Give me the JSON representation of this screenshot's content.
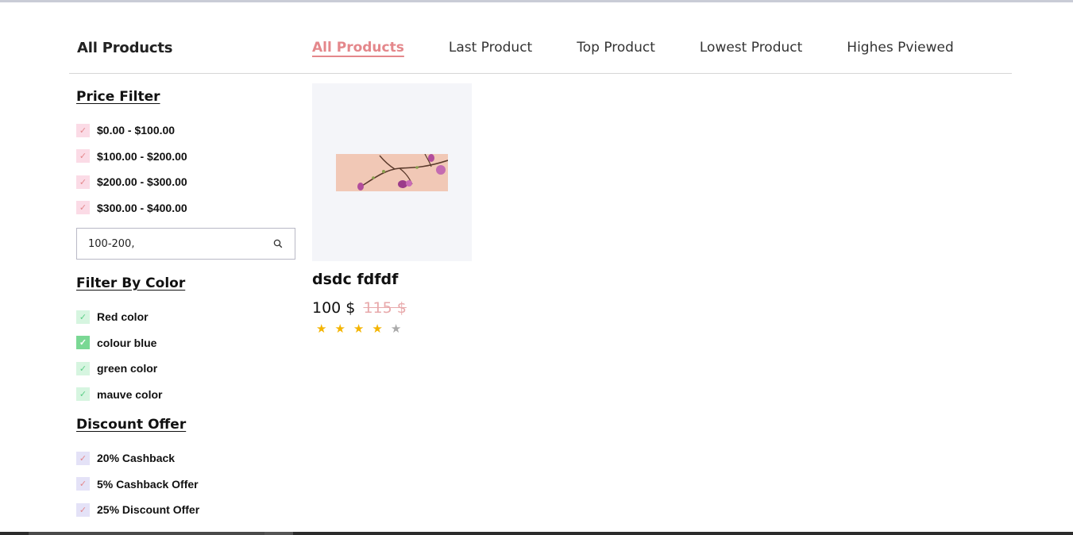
{
  "header": {
    "title": "All Products",
    "tabs": [
      {
        "label": "All Products",
        "active": true
      },
      {
        "label": "Last Product",
        "active": false
      },
      {
        "label": "Top Product",
        "active": false
      },
      {
        "label": "Lowest Product",
        "active": false
      },
      {
        "label": "Highes Pviewed",
        "active": false
      }
    ]
  },
  "sidebar": {
    "price_filter": {
      "title": "Price Filter",
      "items": [
        "$0.00 - $100.00",
        "$100.00 - $200.00",
        "$200.00 - $300.00",
        "$300.00 - $400.00"
      ]
    },
    "search": {
      "value": "100-200,"
    },
    "color_filter": {
      "title": "Filter By Color",
      "items": [
        {
          "label": "Red color",
          "checked": false
        },
        {
          "label": "colour blue",
          "checked": true
        },
        {
          "label": "green color",
          "checked": false
        },
        {
          "label": "mauve color",
          "checked": false
        }
      ]
    },
    "discount_filter": {
      "title": "Discount Offer",
      "items": [
        "20% Cashback",
        "5% Cashback Offer",
        "25% Discount Offer"
      ]
    }
  },
  "product": {
    "name": "dsdc fdfdf",
    "price": "100 $",
    "old_price": "115 $",
    "rating": 4,
    "rating_max": 5
  },
  "colors": {
    "accent": "#e4878b",
    "star": "#f4b400",
    "check_pink": "#fbdbe6",
    "check_green": "#d6f5e0",
    "check_lavender": "#e4e2f7"
  }
}
